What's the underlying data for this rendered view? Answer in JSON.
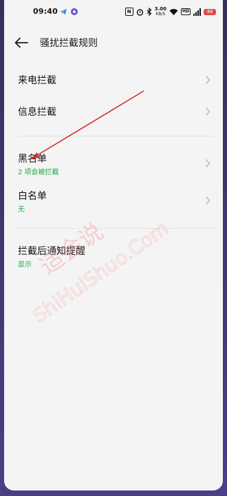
{
  "status_bar": {
    "time": "09:40",
    "icons": [
      "telegram-icon",
      "app-dot-icon",
      "nfc-icon",
      "alarm-icon",
      "bluetooth-icon",
      "network-speed",
      "wifi-icon",
      "hd-icon",
      "signal-icon",
      "battery-icon"
    ],
    "speed_value": "3.00",
    "speed_unit": "KB/S",
    "hd_label": "HD",
    "battery_label": "46"
  },
  "header": {
    "back_icon": "arrow-left-icon",
    "title": "骚扰拦截规则"
  },
  "items": [
    {
      "label": "来电拦截",
      "sub": ""
    },
    {
      "label": "信息拦截",
      "sub": ""
    },
    {
      "label": "黑名单",
      "sub": "2 项会被拦截"
    },
    {
      "label": "白名单",
      "sub": "无"
    },
    {
      "label": "拦截后通知提醒",
      "sub": "显示"
    }
  ],
  "colors": {
    "accent_green": "#28a54a",
    "annotation_arrow": "#d42a2a",
    "watermark": "#f6a3a3"
  },
  "watermark": {
    "text_cn": "适会说",
    "text_en": "ShiHuiShuo.Com"
  }
}
